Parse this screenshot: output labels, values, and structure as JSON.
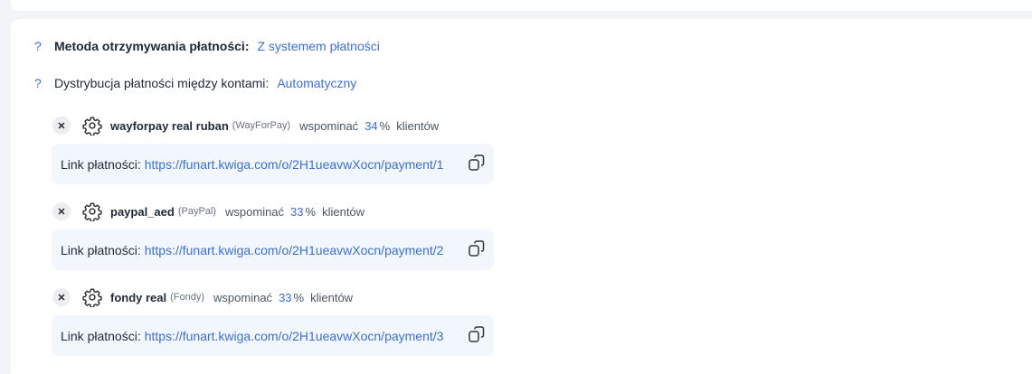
{
  "settings": {
    "method": {
      "help": "?",
      "label": "Metoda otrzymywania płatności:",
      "value": "Z systemem płatności"
    },
    "distribution": {
      "help": "?",
      "label": "Dystrybucja płatności między kontami:",
      "value": "Automatyczny"
    }
  },
  "gateways": [
    {
      "remove_icon": "close-icon",
      "settings_icon": "gear-icon",
      "name": "wayforpay real ruban",
      "type": "(WayForPay)",
      "mention_label": "wspominać",
      "percent": "34",
      "percent_sign": "%",
      "clients_label": "klientów",
      "link_label": "Link płatności:",
      "link_url": "https://funart.kwiga.com/o/2H1ueavwXocn/payment/1",
      "copy_icon": "copy-icon"
    },
    {
      "remove_icon": "close-icon",
      "settings_icon": "gear-icon",
      "name": "paypal_aed",
      "type": "(PayPal)",
      "mention_label": "wspominać",
      "percent": "33",
      "percent_sign": "%",
      "clients_label": "klientów",
      "link_label": "Link płatności:",
      "link_url": "https://funart.kwiga.com/o/2H1ueavwXocn/payment/2",
      "copy_icon": "copy-icon"
    },
    {
      "remove_icon": "close-icon",
      "settings_icon": "gear-icon",
      "name": "fondy real",
      "type": "(Fondy)",
      "mention_label": "wspominać",
      "percent": "33",
      "percent_sign": "%",
      "clients_label": "klientów",
      "link_label": "Link płatności:",
      "link_url": "https://funart.kwiga.com/o/2H1ueavwXocn/payment/3",
      "copy_icon": "copy-icon"
    }
  ],
  "colors": {
    "accent": "#3b6fd9",
    "link_box_bg": "#f2f6fd",
    "page_bg": "#f2f4f7"
  }
}
